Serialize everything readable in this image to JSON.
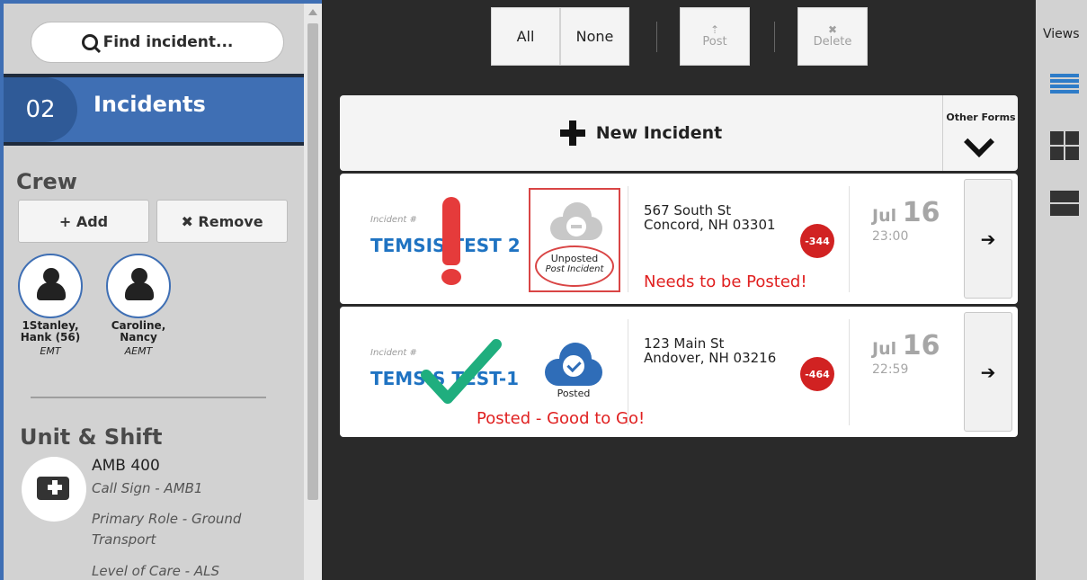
{
  "sidebar": {
    "search_placeholder": "Find incident...",
    "incidents": {
      "count": "02",
      "label": "Incidents"
    },
    "crew": {
      "title": "Crew",
      "add_label": "+ Add",
      "remove_label": "✖ Remove",
      "members": [
        {
          "name_line1": "1Stanley,",
          "name_line2": "Hank (56)",
          "role": "EMT"
        },
        {
          "name_line1": "Caroline,",
          "name_line2": "Nancy",
          "role": "AEMT"
        }
      ]
    },
    "unit": {
      "title": "Unit & Shift",
      "name": "AMB 400",
      "call_sign": "Call Sign - AMB1",
      "primary_role_1": "Primary Role - Ground",
      "primary_role_2": "Transport",
      "level_of_care": "Level of Care - ALS"
    }
  },
  "toolbar": {
    "all_label": "All",
    "none_label": "None",
    "post_label": "Post",
    "delete_label": "Delete"
  },
  "views": {
    "label": "Views"
  },
  "main": {
    "new_incident_label": "New Incident",
    "other_forms_label": "Other Forms",
    "incidents": [
      {
        "number_label": "Incident #",
        "id": "TEMSIS TEST 2",
        "status": "Unposted",
        "status_sub": "Post Incident",
        "address_line1": "567 South St",
        "address_line2": "Concord, NH 03301",
        "badge": "-344",
        "date_month": "Jul",
        "date_day": "16",
        "time": "23:00",
        "note": "Needs to be Posted!"
      },
      {
        "number_label": "Incident #",
        "id": "TEMSIS TEST-1",
        "status": "Posted",
        "address_line1": "123 Main St",
        "address_line2": "Andover, NH 03216",
        "badge": "-464",
        "date_month": "Jul",
        "date_day": "16",
        "time": "22:59",
        "note": "Posted - Good to Go!"
      }
    ]
  },
  "colors": {
    "accent_blue": "#3f6fb4",
    "link_blue": "#1f73c2",
    "alert_red": "#e02020",
    "check_green": "#1fae7e"
  }
}
